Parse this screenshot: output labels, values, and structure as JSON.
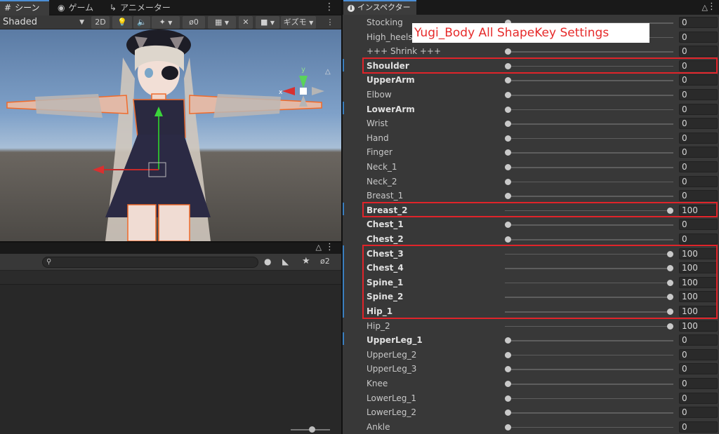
{
  "scene_panel": {
    "tabs": [
      {
        "label": "シーン",
        "icon": "grid-icon"
      },
      {
        "label": "ゲーム",
        "icon": "gamepad-icon"
      },
      {
        "label": "アニメーター",
        "icon": "animator-icon"
      }
    ],
    "shading_mode": "Shaded",
    "toolbar": {
      "btn_2d": "2D",
      "hidden_count": "0",
      "gizmos_label": "ギズモ"
    },
    "gizmo": {
      "axis_y": "y",
      "axis_x": "x"
    }
  },
  "hierarchy_panel": {
    "search_placeholder": "",
    "visibility_count": "2"
  },
  "inspector": {
    "tab_label": "インスペクター",
    "overlay_title": "Yugi_Body All ShapeKey Settings",
    "rows": [
      {
        "label": "Stocking",
        "value": "0",
        "frac": 0,
        "bold": false
      },
      {
        "label": "High_heels",
        "value": "0",
        "frac": 0,
        "bold": false
      },
      {
        "label": "+++ Shrink +++",
        "value": "0",
        "frac": 0,
        "bold": false
      },
      {
        "label": "Shoulder",
        "value": "0",
        "frac": 0,
        "bold": true
      },
      {
        "label": "UpperArm",
        "value": "0",
        "frac": 0,
        "bold": true
      },
      {
        "label": "Elbow",
        "value": "0",
        "frac": 0,
        "bold": false
      },
      {
        "label": "LowerArm",
        "value": "0",
        "frac": 0,
        "bold": true
      },
      {
        "label": "Wrist",
        "value": "0",
        "frac": 0,
        "bold": false
      },
      {
        "label": "Hand",
        "value": "0",
        "frac": 0,
        "bold": false
      },
      {
        "label": "Finger",
        "value": "0",
        "frac": 0,
        "bold": false
      },
      {
        "label": "Neck_1",
        "value": "0",
        "frac": 0,
        "bold": false
      },
      {
        "label": "Neck_2",
        "value": "0",
        "frac": 0,
        "bold": false
      },
      {
        "label": "Breast_1",
        "value": "0",
        "frac": 0,
        "bold": false
      },
      {
        "label": "Breast_2",
        "value": "100",
        "frac": 1,
        "bold": true
      },
      {
        "label": "Chest_1",
        "value": "0",
        "frac": 0,
        "bold": true
      },
      {
        "label": "Chest_2",
        "value": "0",
        "frac": 0,
        "bold": true
      },
      {
        "label": "Chest_3",
        "value": "100",
        "frac": 1,
        "bold": true
      },
      {
        "label": "Chest_4",
        "value": "100",
        "frac": 1,
        "bold": true
      },
      {
        "label": "Spine_1",
        "value": "100",
        "frac": 1,
        "bold": true
      },
      {
        "label": "Spine_2",
        "value": "100",
        "frac": 1,
        "bold": true
      },
      {
        "label": "Hip_1",
        "value": "100",
        "frac": 1,
        "bold": true
      },
      {
        "label": "Hip_2",
        "value": "100",
        "frac": 1,
        "bold": false
      },
      {
        "label": "UpperLeg_1",
        "value": "0",
        "frac": 0,
        "bold": true
      },
      {
        "label": "UpperLeg_2",
        "value": "0",
        "frac": 0,
        "bold": false
      },
      {
        "label": "UpperLeg_3",
        "value": "0",
        "frac": 0,
        "bold": false
      },
      {
        "label": "Knee",
        "value": "0",
        "frac": 0,
        "bold": false
      },
      {
        "label": "LowerLeg_1",
        "value": "0",
        "frac": 0,
        "bold": false
      },
      {
        "label": "LowerLeg_2",
        "value": "0",
        "frac": 0,
        "bold": false
      },
      {
        "label": "Ankle",
        "value": "0",
        "frac": 0,
        "bold": false
      }
    ]
  },
  "colors": {
    "highlight": "#e0242a",
    "overlay_text": "#e62a2a",
    "accent_blue": "#4c8fd6"
  }
}
